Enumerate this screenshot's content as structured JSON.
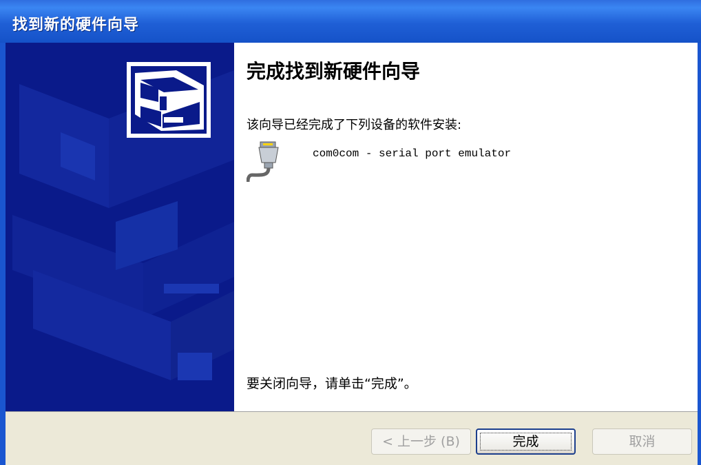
{
  "window": {
    "title": "找到新的硬件向导"
  },
  "content": {
    "heading": "完成找到新硬件向导",
    "intro": "该向导已经完成了下列设备的软件安装:",
    "device_name": "com0com - serial port emulator",
    "device_icon": "serial-port-icon",
    "closing": "要关闭向导，请单击“完成”。"
  },
  "buttons": {
    "back": "< 上一步 (B)",
    "finish": "完成",
    "cancel": "取消"
  },
  "colors": {
    "titlebar": "#1f5fd6",
    "banner": "#0a1a8a",
    "footer": "#ece9d8"
  }
}
